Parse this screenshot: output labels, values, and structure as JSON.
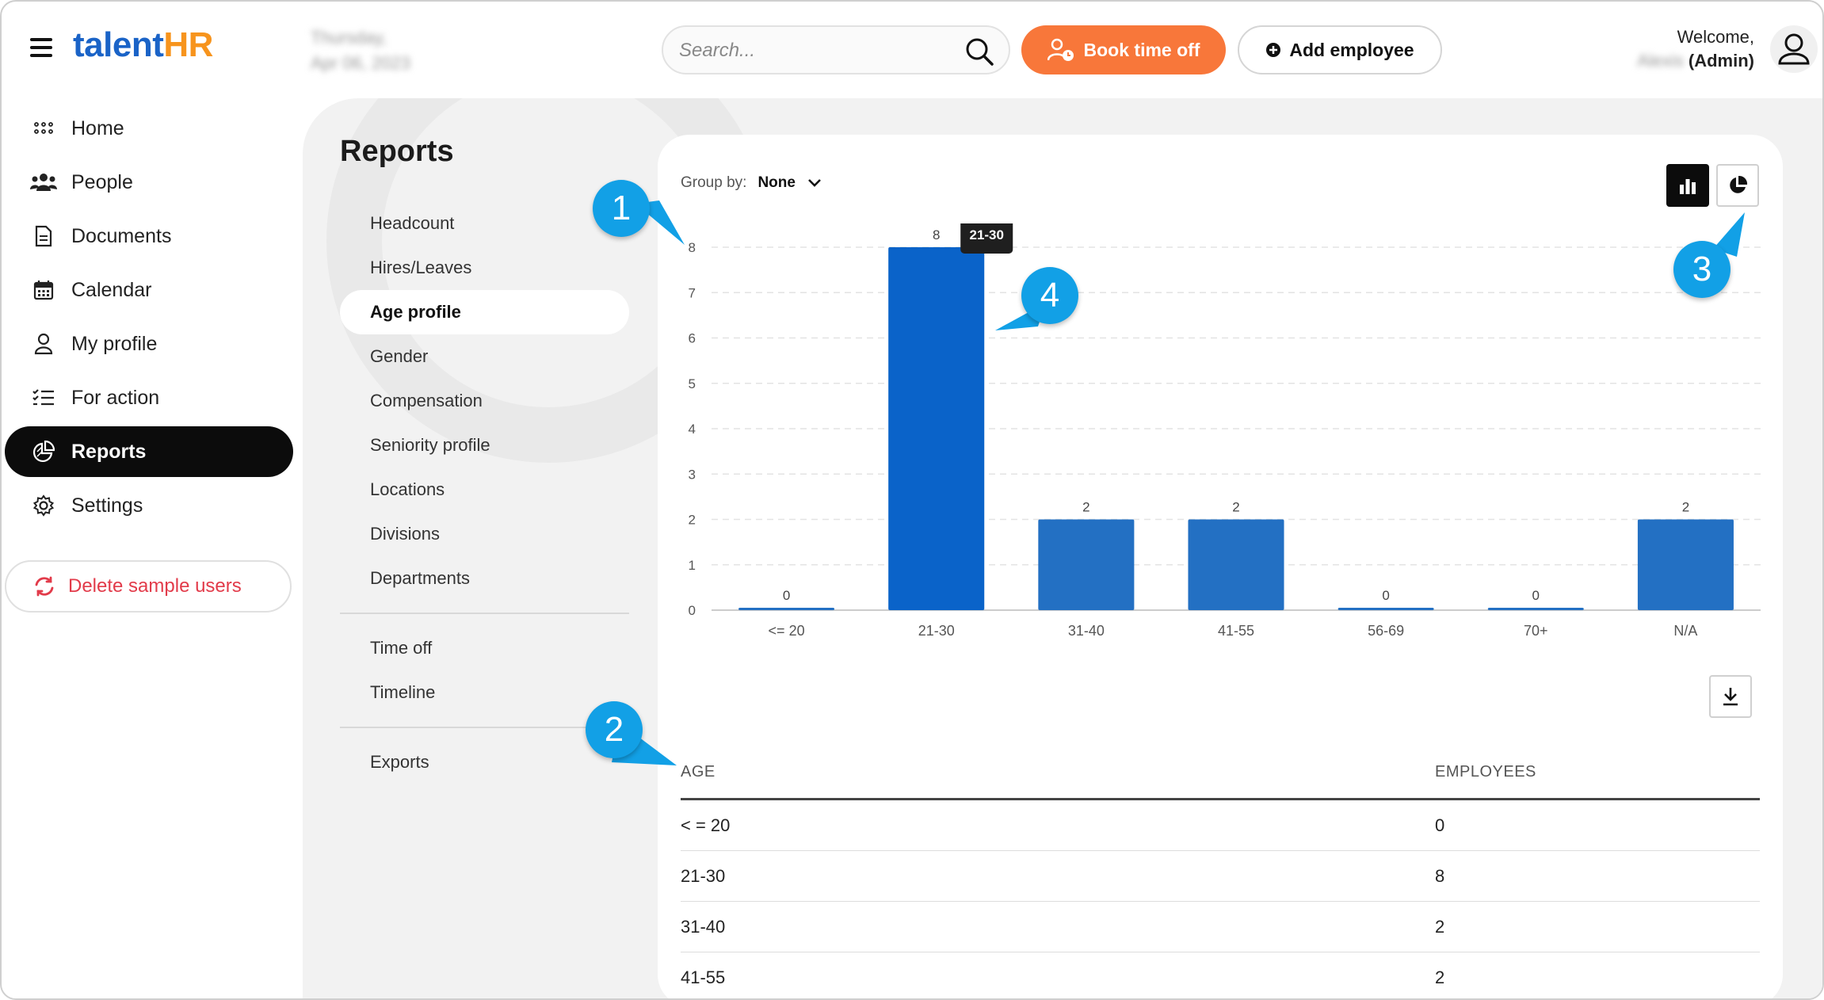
{
  "app": {
    "logo_talent": "talent",
    "logo_hr": "HR"
  },
  "header": {
    "date_line1": "Thursday,",
    "date_line2": "Apr 06, 2023",
    "search_placeholder": "Search...",
    "book_label": "Book time off",
    "add_label": "Add employee",
    "welcome": "Welcome,",
    "user_name": "Alexis",
    "role": "(Admin)",
    "accent": "#f8773a"
  },
  "sidebar": {
    "items": [
      {
        "label": "Home",
        "icon": "grid-icon"
      },
      {
        "label": "People",
        "icon": "people-icon"
      },
      {
        "label": "Documents",
        "icon": "document-icon"
      },
      {
        "label": "Calendar",
        "icon": "calendar-icon"
      },
      {
        "label": "My profile",
        "icon": "user-icon"
      },
      {
        "label": "For action",
        "icon": "checklist-icon"
      },
      {
        "label": "Reports",
        "icon": "pie-chart-icon",
        "active": true
      },
      {
        "label": "Settings",
        "icon": "gear-icon"
      }
    ],
    "delete_label": "Delete sample users"
  },
  "reports": {
    "title": "Reports",
    "nav": [
      "Headcount",
      "Hires/Leaves",
      "Age profile",
      "Gender",
      "Compensation",
      "Seniority profile",
      "Locations",
      "Divisions",
      "Departments"
    ],
    "nav2": [
      "Time off",
      "Timeline"
    ],
    "nav3": [
      "Exports"
    ],
    "active": "Age profile"
  },
  "groupby": {
    "label": "Group by:",
    "value": "None"
  },
  "tooltip": "21-30",
  "chart_data": {
    "type": "bar",
    "categories": [
      "<= 20",
      "21-30",
      "31-40",
      "41-55",
      "56-69",
      "70+",
      "N/A"
    ],
    "values": [
      0,
      8,
      2,
      2,
      0,
      0,
      2
    ],
    "ylim": [
      0,
      8
    ],
    "yticks": [
      0,
      1,
      2,
      3,
      4,
      5,
      6,
      7,
      8
    ],
    "grid": true,
    "color": "#2370c3",
    "highlight_color": "#0a63c9",
    "highlight_index": 1
  },
  "table": {
    "headers": [
      "AGE",
      "EMPLOYEES"
    ],
    "rows": [
      [
        "< = 20",
        "0"
      ],
      [
        "21-30",
        "8"
      ],
      [
        "31-40",
        "2"
      ],
      [
        "41-55",
        "2"
      ]
    ]
  },
  "annotations": [
    "1",
    "2",
    "3",
    "4"
  ]
}
